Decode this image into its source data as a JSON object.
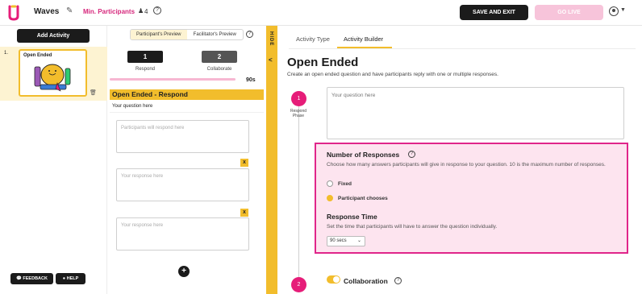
{
  "topbar": {
    "app_title": "Waves",
    "min_participants_label": "Min. Participants",
    "participant_count": "4",
    "help": "?",
    "save_exit": "SAVE AND EXIT",
    "go_live": "GO LIVE",
    "colors": {
      "brand": "#e61d79",
      "accent": "#f2bd2c",
      "dark": "#1b1b1b"
    }
  },
  "slides": {
    "add_activity": "Add Activity",
    "items": [
      {
        "number": "1.",
        "title": "Open Ended"
      }
    ],
    "feedback": "FEEDBACK",
    "help": "HELP"
  },
  "preview": {
    "tabs": [
      "Participant's Preview",
      "Facilitator's Preview"
    ],
    "help": "?",
    "phases": [
      {
        "number": "1",
        "label": "Respond"
      },
      {
        "number": "2",
        "label": "Collaborate"
      }
    ],
    "timer": "90s",
    "question_title": "Open Ended - Respond",
    "question_text": "Your question here",
    "response_placeholders": [
      "Participants will respond here",
      "Your response here",
      "Your response here"
    ],
    "remove": "x",
    "add": "+"
  },
  "hide_strip": {
    "label": "HIDE",
    "caret": "<"
  },
  "builder": {
    "tabs": [
      "Activity Type",
      "Activity Builder"
    ],
    "title": "Open Ended",
    "description": "Create an open ended question and have participants reply with one or multiple responses.",
    "steps": [
      {
        "number": "1",
        "label": "Respond Phase"
      },
      {
        "number": "2"
      }
    ],
    "question_placeholder": "Your question here",
    "responses": {
      "heading": "Number of Responses",
      "help": "?",
      "description": "Choose how many answers participants will give in response to your question. 10 is the maximum number of responses.",
      "options": [
        "Fixed",
        "Participant chooses"
      ],
      "selected": "Participant chooses"
    },
    "response_time": {
      "heading": "Response Time",
      "description": "Set the time that participants will have to answer the question individually.",
      "value": "90 secs"
    },
    "collaboration": {
      "label": "Collaboration",
      "help": "?",
      "enabled": true
    }
  }
}
